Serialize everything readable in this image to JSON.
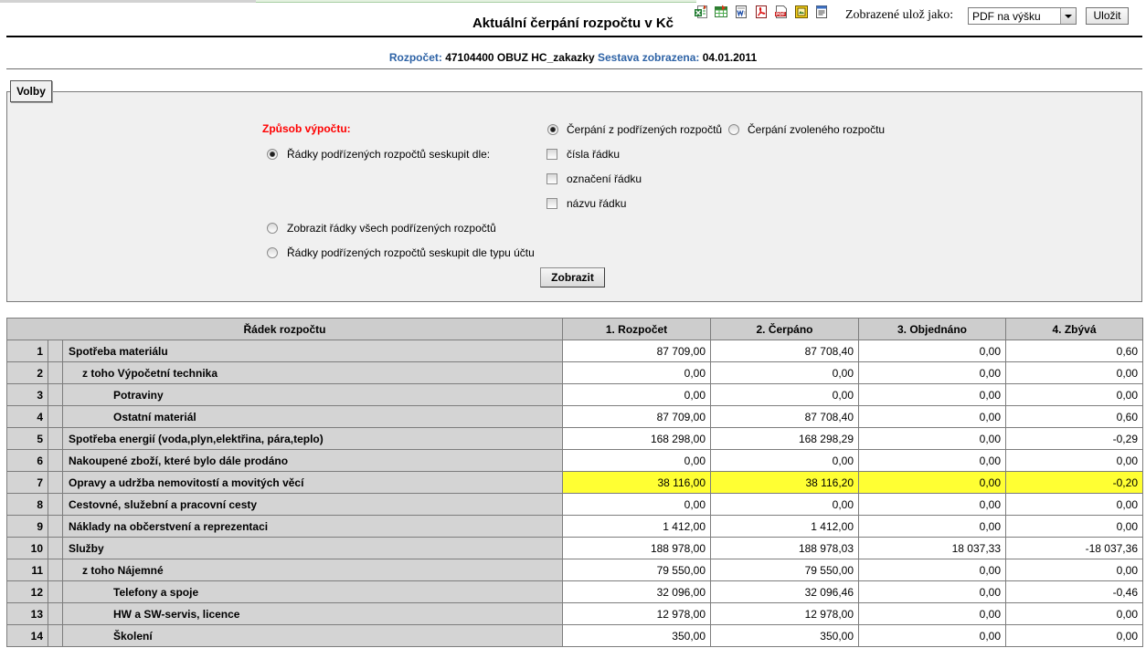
{
  "window": {
    "title": "Aktuální čerpání rozpočtu v Kč"
  },
  "toolbar": {
    "export_icons": [
      "excel-export-icon",
      "excel-table-export-icon",
      "word-export-icon",
      "pdf-export-icon",
      "pdf-document-export-icon",
      "image-export-icon",
      "text-export-icon"
    ],
    "save_as_label": "Zobrazené ulož jako:",
    "save_format": {
      "selected": "PDF na výšku"
    },
    "save_button": "Uložit"
  },
  "info": {
    "budget_label": "Rozpočet:",
    "budget_value": "47104400 OBUZ HC_zakazky",
    "report_label": "Sestava zobrazena:",
    "report_date": "04.01.2011"
  },
  "options": {
    "legend": "Volby",
    "method_label": "Způsob výpočtu:",
    "method": [
      {
        "label": "Čerpání z podřízených rozpočtů",
        "checked": true
      },
      {
        "label": "Čerpání zvoleného rozpočtu",
        "checked": false
      }
    ],
    "row_modes": [
      {
        "label": "Řádky podřízených rozpočtů seskupit dle:",
        "checked": true
      },
      {
        "label": "Zobrazit řádky všech podřízených rozpočtů",
        "checked": false
      },
      {
        "label": "Řádky podřízených rozpočtů seskupit dle typu účtu",
        "checked": false
      }
    ],
    "group_by": [
      {
        "label": "čísla řádku",
        "checked": false
      },
      {
        "label": "označení řádku",
        "checked": false
      },
      {
        "label": "názvu řádku",
        "checked": false
      }
    ],
    "submit": "Zobrazit"
  },
  "table": {
    "columns": {
      "row": "Řádek rozpočtu",
      "budget": "1. Rozpočet",
      "spent": "2. Čerpáno",
      "ordered": "3. Objednáno",
      "remaining": "4. Zbývá"
    },
    "rows": [
      {
        "num": "1",
        "name": "Spotřeba materiálu",
        "level": 0,
        "highlight": false,
        "budget": "87 709,00",
        "spent": "87 708,40",
        "ordered": "0,00",
        "remaining": "0,60"
      },
      {
        "num": "2",
        "name": "z toho Výpočetní technika",
        "level": 1,
        "highlight": false,
        "budget": "0,00",
        "spent": "0,00",
        "ordered": "0,00",
        "remaining": "0,00"
      },
      {
        "num": "3",
        "name": "Potraviny",
        "level": 2,
        "highlight": false,
        "budget": "0,00",
        "spent": "0,00",
        "ordered": "0,00",
        "remaining": "0,00"
      },
      {
        "num": "4",
        "name": "Ostatní materiál",
        "level": 2,
        "highlight": false,
        "budget": "87 709,00",
        "spent": "87 708,40",
        "ordered": "0,00",
        "remaining": "0,60"
      },
      {
        "num": "5",
        "name": "Spotřeba energií (voda,plyn,elektřina, pára,teplo)",
        "level": 0,
        "highlight": false,
        "budget": "168 298,00",
        "spent": "168 298,29",
        "ordered": "0,00",
        "remaining": "-0,29"
      },
      {
        "num": "6",
        "name": "Nakoupené zboží, které bylo dále prodáno",
        "level": 0,
        "highlight": false,
        "budget": "0,00",
        "spent": "0,00",
        "ordered": "0,00",
        "remaining": "0,00"
      },
      {
        "num": "7",
        "name": "Opravy a udržba nemovitostí a movitých věcí",
        "level": 0,
        "highlight": true,
        "budget": "38 116,00",
        "spent": "38 116,20",
        "ordered": "0,00",
        "remaining": "-0,20"
      },
      {
        "num": "8",
        "name": "Cestovné, služební a pracovní cesty",
        "level": 0,
        "highlight": false,
        "budget": "0,00",
        "spent": "0,00",
        "ordered": "0,00",
        "remaining": "0,00"
      },
      {
        "num": "9",
        "name": "Náklady na občerstvení a reprezentaci",
        "level": 0,
        "highlight": false,
        "budget": "1 412,00",
        "spent": "1 412,00",
        "ordered": "0,00",
        "remaining": "0,00"
      },
      {
        "num": "10",
        "name": "Služby",
        "level": 0,
        "highlight": false,
        "budget": "188 978,00",
        "spent": "188 978,03",
        "ordered": "18 037,33",
        "remaining": "-18 037,36"
      },
      {
        "num": "11",
        "name": "z toho Nájemné",
        "level": 1,
        "highlight": false,
        "budget": "79 550,00",
        "spent": "79 550,00",
        "ordered": "0,00",
        "remaining": "0,00"
      },
      {
        "num": "12",
        "name": "Telefony a spoje",
        "level": 2,
        "highlight": false,
        "budget": "32 096,00",
        "spent": "32 096,46",
        "ordered": "0,00",
        "remaining": "-0,46"
      },
      {
        "num": "13",
        "name": "HW a SW-servis, licence",
        "level": 2,
        "highlight": false,
        "budget": "12 978,00",
        "spent": "12 978,00",
        "ordered": "0,00",
        "remaining": "0,00"
      },
      {
        "num": "14",
        "name": "Školení",
        "level": 2,
        "highlight": false,
        "budget": "350,00",
        "spent": "350,00",
        "ordered": "0,00",
        "remaining": "0,00"
      }
    ]
  },
  "colors": {
    "label_blue": "#2e63a6",
    "method_label_red": "#ff0000",
    "highlight_yellow": "#ffff33",
    "header_gray": "#cdcdcd",
    "row_gray": "#d4d4d4"
  }
}
